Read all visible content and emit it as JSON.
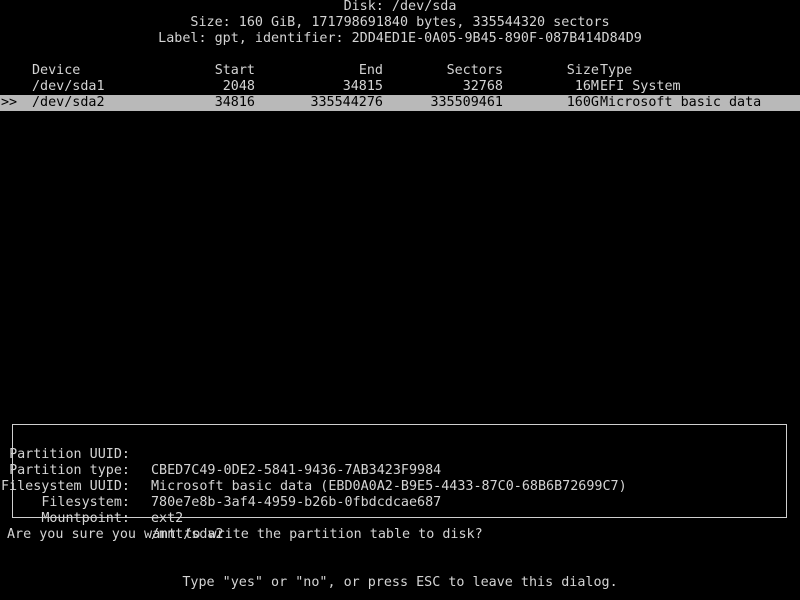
{
  "header": {
    "disk": "Disk: /dev/sda",
    "size": "Size: 160 GiB, 171798691840 bytes, 335544320 sectors",
    "label": "Label: gpt, identifier: 2DD4ED1E-0A05-9B45-890F-087B414D84D9"
  },
  "table": {
    "columns": {
      "device": "Device",
      "start": "Start",
      "end": "End",
      "sectors": "Sectors",
      "size": "Size",
      "type": "Type"
    },
    "rows": [
      {
        "cursor": "",
        "device": "/dev/sda1",
        "start": "2048",
        "end": "34815",
        "sectors": "32768",
        "size": "16M",
        "type": "EFI System",
        "selected": false
      },
      {
        "cursor": ">>",
        "device": "/dev/sda2",
        "start": "34816",
        "end": "335544276",
        "sectors": "335509461",
        "size": "160G",
        "type": "Microsoft basic data",
        "selected": true
      }
    ]
  },
  "info": {
    "items": [
      {
        "label": "Partition UUID:",
        "value": "CBED7C49-0DE2-5841-9436-7AB3423F9984"
      },
      {
        "label": "Partition type:",
        "value": "Microsoft basic data (EBD0A0A2-B9E5-4433-87C0-68B6B72699C7)"
      },
      {
        "label": "Filesystem UUID:",
        "value": "780e7e8b-3af4-4959-b26b-0fbdcdcae687"
      },
      {
        "label": "Filesystem:",
        "value": "ext2"
      },
      {
        "label": "Mountpoint:",
        "value": "/mnt/sda2"
      }
    ]
  },
  "prompt": "Are you sure you want to write the partition table to disk?",
  "hint": "Type \"yes\" or \"no\", or press ESC to leave this dialog.",
  "colors": {
    "background": "#000000",
    "foreground": "#d4d4d4",
    "selection": "#b9b9b9"
  }
}
